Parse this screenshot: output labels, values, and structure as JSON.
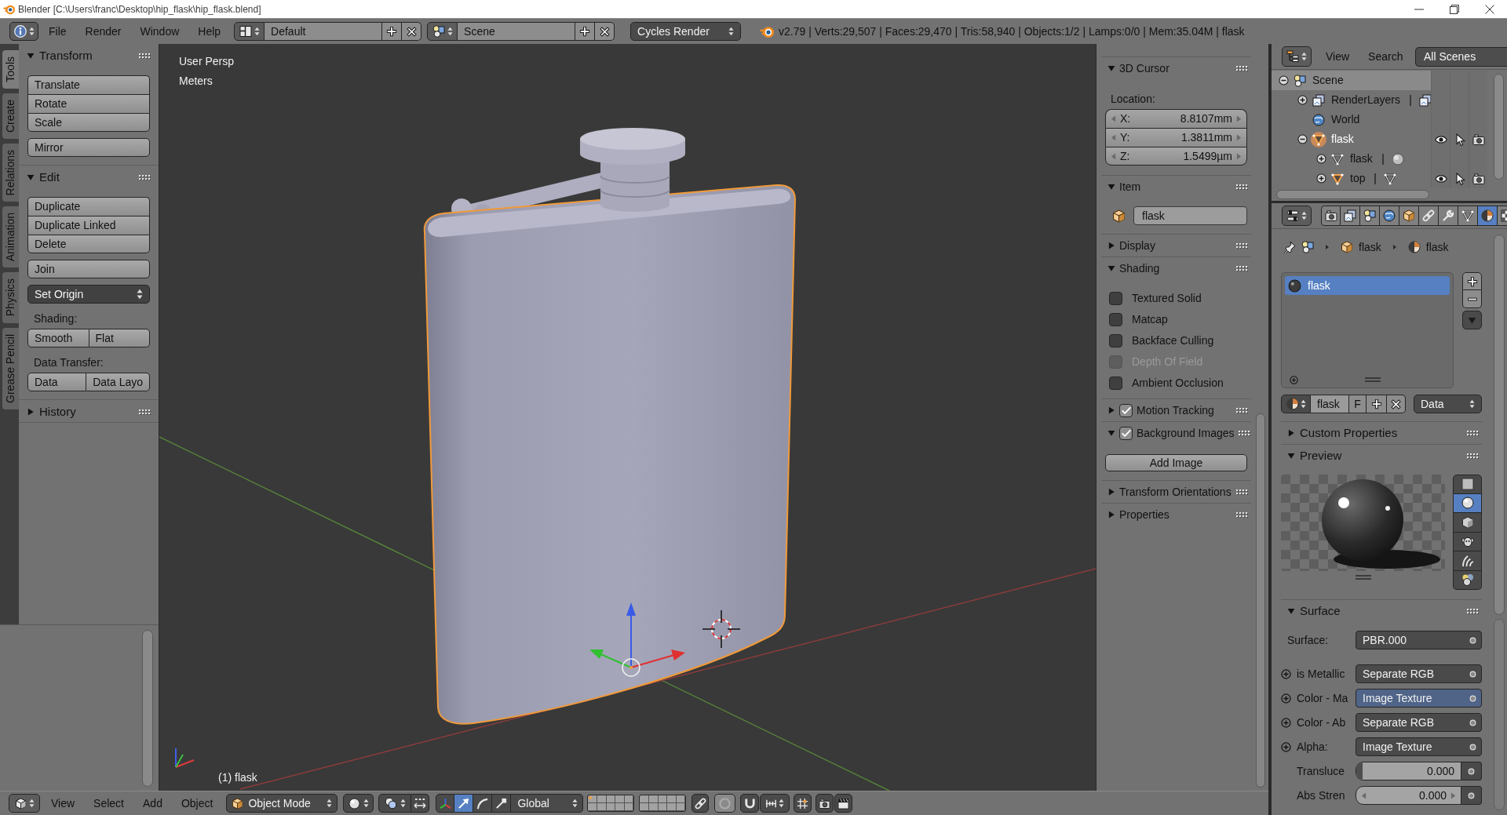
{
  "title_bar": {
    "title": "Blender [C:\\Users\\franc\\Desktop\\hip_flask\\hip_flask.blend]"
  },
  "info_header": {
    "menus": [
      "File",
      "Render",
      "Window",
      "Help"
    ],
    "screen_layout": "Default",
    "scene": "Scene",
    "render_engine": "Cycles Render",
    "stats": "v2.79 | Verts:29,507 | Faces:29,470 | Tris:58,940 | Objects:1/2 | Lamps:0/0 | Mem:35.04M | flask"
  },
  "tool_shelf": {
    "tabs": [
      {
        "label": "Tools",
        "selected": true
      },
      {
        "label": "Create",
        "selected": false
      },
      {
        "label": "Relations",
        "selected": false
      },
      {
        "label": "Animation",
        "selected": false
      },
      {
        "label": "Physics",
        "selected": false
      },
      {
        "label": "Grease Pencil",
        "selected": false
      }
    ],
    "panels": [
      {
        "title": "Transform",
        "expanded": true,
        "items": [
          {
            "kind": "buttons",
            "labels": [
              "Translate",
              "Rotate",
              "Scale"
            ]
          },
          {
            "kind": "buttons",
            "labels": [
              "Mirror"
            ]
          }
        ]
      },
      {
        "title": "Edit",
        "expanded": true,
        "items": [
          {
            "kind": "buttons",
            "labels": [
              "Duplicate",
              "Duplicate Linked",
              "Delete"
            ]
          },
          {
            "kind": "buttons",
            "labels": [
              "Join"
            ]
          },
          {
            "kind": "dropdown",
            "label": "Set Origin"
          },
          {
            "kind": "caption",
            "label": "Shading:"
          },
          {
            "kind": "button_row",
            "labels": [
              "Smooth",
              "Flat"
            ]
          },
          {
            "kind": "caption",
            "label": "Data Transfer:"
          },
          {
            "kind": "button_row",
            "labels": [
              "Data",
              "Data Layo"
            ]
          }
        ]
      },
      {
        "title": "History",
        "expanded": false
      }
    ]
  },
  "viewport": {
    "view_name": "User Persp",
    "units": "Meters",
    "object_info": "(1) flask"
  },
  "n_panel": {
    "panels": [
      {
        "title": "3D Cursor",
        "expanded": true,
        "content": {
          "kind": "vector",
          "caption": "Location:",
          "fields": [
            {
              "label": "X:",
              "value": "8.8107mm"
            },
            {
              "label": "Y:",
              "value": "1.3811mm"
            },
            {
              "label": "Z:",
              "value": "1.5499µm"
            }
          ]
        }
      },
      {
        "title": "Item",
        "expanded": true,
        "content": {
          "kind": "name",
          "value": "flask"
        }
      },
      {
        "title": "Display",
        "expanded": false
      },
      {
        "title": "Shading",
        "expanded": true,
        "content": {
          "kind": "checkboxes",
          "options": [
            {
              "label": "Textured Solid",
              "checked": false,
              "disabled": false
            },
            {
              "label": "Matcap",
              "checked": false,
              "disabled": false
            },
            {
              "label": "Backface Culling",
              "checked": false,
              "disabled": false
            },
            {
              "label": "Depth Of Field",
              "checked": false,
              "disabled": true
            },
            {
              "label": "Ambient Occlusion",
              "checked": false,
              "disabled": false
            }
          ]
        }
      },
      {
        "title": "Motion Tracking",
        "expanded": false,
        "checked": true
      },
      {
        "title": "Background Images",
        "expanded": true,
        "checked": true,
        "content": {
          "kind": "button",
          "label": "Add Image"
        }
      },
      {
        "title": "Transform Orientations",
        "expanded": false
      },
      {
        "title": "Properties",
        "expanded": false
      }
    ]
  },
  "outliner": {
    "menus": [
      "View",
      "Search"
    ],
    "filter": "All Scenes",
    "tree": [
      {
        "kind": "scene",
        "label": "Scene",
        "expanded": true,
        "selected": true,
        "active": false,
        "children": [
          {
            "kind": "render_layers",
            "label": "RenderLayers",
            "expanded": false,
            "selected": false,
            "active": false
          },
          {
            "kind": "world",
            "label": "World",
            "selected": false,
            "active": false
          },
          {
            "kind": "object",
            "label": "flask",
            "expanded": true,
            "selected": false,
            "active": true,
            "children": [
              {
                "kind": "mesh",
                "label": "flask",
                "expanded": false,
                "selected": false,
                "active": false
              },
              {
                "kind": "object",
                "label": "top",
                "expanded": false,
                "selected": false,
                "active": false
              }
            ]
          }
        ]
      }
    ]
  },
  "properties": {
    "tabs": [
      {
        "kind": "render",
        "selected": false
      },
      {
        "kind": "render_layers",
        "selected": false
      },
      {
        "kind": "scene",
        "selected": false
      },
      {
        "kind": "world",
        "selected": false
      },
      {
        "kind": "object",
        "selected": false
      },
      {
        "kind": "constraints",
        "selected": false
      },
      {
        "kind": "modifiers",
        "selected": false
      },
      {
        "kind": "data",
        "selected": false
      },
      {
        "kind": "material",
        "selected": true
      },
      {
        "kind": "texture",
        "selected": false
      }
    ],
    "breadcrumb": [
      {
        "kind": "scene"
      },
      {
        "kind": "object",
        "label": "flask"
      },
      {
        "kind": "material",
        "label": "flask"
      }
    ],
    "slots": [
      {
        "name": "flask",
        "selected": true
      }
    ],
    "material": {
      "name": "flask",
      "fake_user": "F",
      "link": "Data"
    },
    "panels": [
      {
        "title": "Custom Properties",
        "expanded": false
      },
      {
        "title": "Preview",
        "expanded": true,
        "content": {
          "kind": "preview",
          "shapes": [
            {
              "kind": "flat",
              "selected": false
            },
            {
              "kind": "sphere",
              "selected": true
            },
            {
              "kind": "cube",
              "selected": false
            },
            {
              "kind": "monkey",
              "selected": false
            },
            {
              "kind": "hair",
              "selected": false
            },
            {
              "kind": "sphere_sky",
              "selected": false
            }
          ]
        }
      },
      {
        "title": "Surface",
        "expanded": true,
        "content": {
          "kind": "shader",
          "surface_label": "Surface:",
          "surface": "PBR.000",
          "inputs": [
            {
              "kind": "link",
              "label": "is Metallic",
              "value": "Separate RGB",
              "highlighted": false
            },
            {
              "kind": "link",
              "label": "Color - Ma",
              "value": "Image Texture",
              "highlighted": true
            },
            {
              "kind": "link",
              "label": "Color - Ab",
              "value": "Separate RGB",
              "highlighted": false
            },
            {
              "kind": "link",
              "label": "Alpha:",
              "value": "Image Texture",
              "highlighted": false
            },
            {
              "kind": "slider",
              "label": "Transluce",
              "value": "0.000",
              "level": 0
            },
            {
              "kind": "number",
              "label": "Abs Stren",
              "value": "0.000"
            }
          ]
        }
      }
    ]
  },
  "view_header": {
    "menus": [
      "View",
      "Select",
      "Add",
      "Object"
    ],
    "mode": "Object Mode",
    "manipulators": [
      {
        "kind": "toggle",
        "selected": false
      },
      {
        "kind": "translate",
        "selected": true
      },
      {
        "kind": "rotate",
        "selected": false
      },
      {
        "kind": "scale",
        "selected": false
      }
    ],
    "orientation": "Global",
    "layers": [
      {
        "occupied": true
      },
      {
        "occupied": false
      },
      {
        "occupied": false
      },
      {
        "occupied": false
      },
      {
        "occupied": false
      },
      {
        "occupied": false
      },
      {
        "occupied": false
      },
      {
        "occupied": false
      },
      {
        "occupied": false
      },
      {
        "occupied": false
      },
      {
        "occupied": false
      },
      {
        "occupied": false
      },
      {
        "occupied": false
      },
      {
        "occupied": false
      },
      {
        "occupied": false
      },
      {
        "occupied": false
      },
      {
        "occupied": false
      },
      {
        "occupied": false
      },
      {
        "occupied": false
      },
      {
        "occupied": false
      }
    ]
  }
}
